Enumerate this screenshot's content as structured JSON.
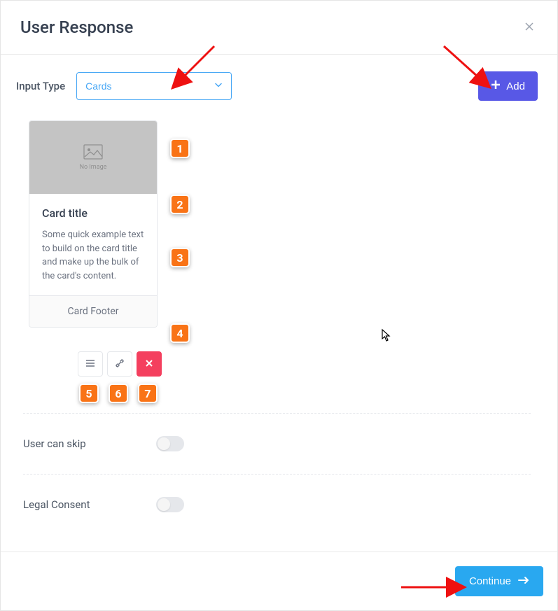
{
  "header": {
    "title": "User Response"
  },
  "input": {
    "label": "Input Type",
    "value": "Cards",
    "add_label": "Add"
  },
  "card": {
    "no_image": "No Image",
    "title": "Card title",
    "text": "Some quick example text to build on the card title and make up the bulk of the card's content.",
    "footer": "Card Footer"
  },
  "markers": {
    "m1": "1",
    "m2": "2",
    "m3": "3",
    "m4": "4",
    "m5": "5",
    "m6": "6",
    "m7": "7"
  },
  "toggles": {
    "skip": "User can skip",
    "legal": "Legal Consent"
  },
  "footer": {
    "continue": "Continue"
  }
}
